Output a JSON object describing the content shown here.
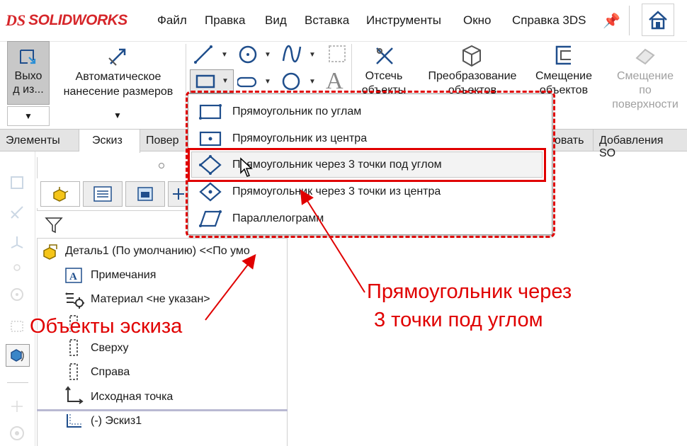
{
  "app": {
    "logo_ds": "DS",
    "logo_text": "SOLIDWORKS"
  },
  "menubar": {
    "items": [
      "Файл",
      "Правка",
      "Вид",
      "Вставка",
      "Инструменты",
      "Окно",
      "Справка 3DS"
    ]
  },
  "ribbon": {
    "exit_label": "Выхо\nд из...",
    "exit_label_line1": "Выхо",
    "exit_label_line2": "д из...",
    "auto_dim_line1": "Автоматическое",
    "auto_dim_line2": "нанесение размеров",
    "trim_line1": "Отсечь",
    "trim_line2": "объекты",
    "convert_line1": "Преобразование",
    "convert_line2": "объектов",
    "offset_line1": "Смещение",
    "offset_line2": "объектов",
    "surface_offset_line1": "Смещение",
    "surface_offset_line2": "по",
    "surface_offset_line3": "поверхности"
  },
  "tabs": {
    "items": [
      "Элементы",
      "Эскиз",
      "Повер",
      "овать",
      "Добавления SO"
    ]
  },
  "feature_tree": {
    "root": "Деталь1 (По умолчанию) <<По умо",
    "items": [
      {
        "label": "Примечания",
        "icon": "annotations-icon"
      },
      {
        "label": "Материал <не указан>",
        "icon": "material-icon"
      },
      {
        "label": "Сверху",
        "icon": "plane-icon"
      },
      {
        "label": "Справа",
        "icon": "plane-icon"
      },
      {
        "label": "Исходная точка",
        "icon": "origin-icon"
      },
      {
        "label": "(-) Эскиз1",
        "icon": "sketch-icon"
      }
    ]
  },
  "dropdown": {
    "items": [
      {
        "label": "Прямоугольник по углам",
        "icon": "corner-rectangle-icon"
      },
      {
        "label": "Прямоугольник из центра",
        "icon": "center-rectangle-icon"
      },
      {
        "label": "Прямоугольник через 3 точки под углом",
        "icon": "3point-corner-rectangle-icon"
      },
      {
        "label": "Прямоугольник через 3 точки из центра",
        "icon": "3point-center-rectangle-icon"
      },
      {
        "label": "Параллелограмм",
        "icon": "parallelogram-icon"
      }
    ],
    "selected_index": 2
  },
  "annotations": {
    "callout_left": "Объекты эскиза",
    "callout_right_line1": "Прямоугольник через",
    "callout_right_line2": "3 точки под углом"
  },
  "colors": {
    "accent_red": "#e00000",
    "brand_red": "#d6262a",
    "icon_blue": "#1f4e8c"
  }
}
